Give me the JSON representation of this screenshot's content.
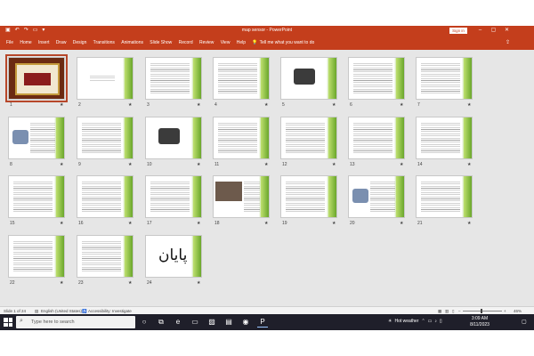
{
  "window": {
    "title": "map sensor  -  PowerPoint",
    "sign_in": "Sign in",
    "qat_icons": [
      "save-icon",
      "undo-icon",
      "redo-icon",
      "present-icon",
      "customize-icon"
    ],
    "window_buttons": [
      "minimize-icon",
      "restore-icon",
      "close-icon"
    ]
  },
  "ribbon": {
    "tabs": [
      "File",
      "Home",
      "Insert",
      "Draw",
      "Design",
      "Transitions",
      "Animations",
      "Slide Show",
      "Record",
      "Review",
      "View",
      "Help"
    ],
    "tell_me": "Tell me what you want to do",
    "share_icon": "share-icon"
  },
  "slides": [
    {
      "num": "1",
      "kind": "cover"
    },
    {
      "num": "2",
      "kind": "title"
    },
    {
      "num": "3",
      "kind": "text"
    },
    {
      "num": "4",
      "kind": "text"
    },
    {
      "num": "5",
      "kind": "image"
    },
    {
      "num": "6",
      "kind": "text"
    },
    {
      "num": "7",
      "kind": "text"
    },
    {
      "num": "8",
      "kind": "diagram"
    },
    {
      "num": "9",
      "kind": "text"
    },
    {
      "num": "10",
      "kind": "image"
    },
    {
      "num": "11",
      "kind": "text"
    },
    {
      "num": "12",
      "kind": "text"
    },
    {
      "num": "13",
      "kind": "text"
    },
    {
      "num": "14",
      "kind": "text"
    },
    {
      "num": "15",
      "kind": "text"
    },
    {
      "num": "16",
      "kind": "text"
    },
    {
      "num": "17",
      "kind": "text"
    },
    {
      "num": "18",
      "kind": "photo"
    },
    {
      "num": "19",
      "kind": "text"
    },
    {
      "num": "20",
      "kind": "diagram"
    },
    {
      "num": "21",
      "kind": "text"
    },
    {
      "num": "22",
      "kind": "text"
    },
    {
      "num": "23",
      "kind": "text"
    },
    {
      "num": "24",
      "kind": "end",
      "text": "پایان"
    }
  ],
  "selected_slide": "1",
  "star_glyph": "★",
  "status": {
    "slide_counter": "Slide 1 of 24",
    "language": "English (United States)",
    "accessibility": "Accessibility: Investigate",
    "zoom": "46%"
  },
  "taskbar": {
    "search_placeholder": "Type here to search",
    "weather": "Hot weather",
    "time": "3:09 AM",
    "date": "8/11/2023"
  }
}
